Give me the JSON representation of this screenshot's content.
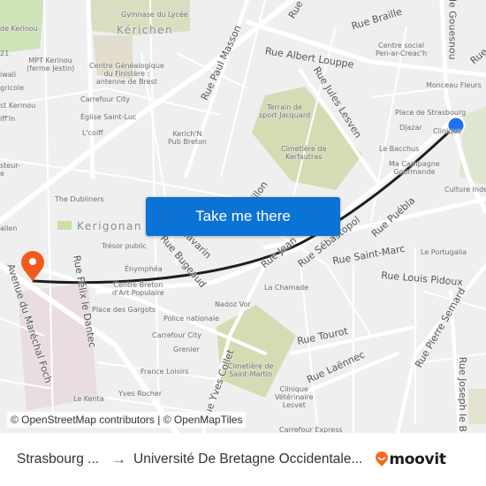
{
  "map": {
    "districts": [
      {
        "id": "kerichen",
        "label": "Kérichen"
      },
      {
        "id": "kerigonan",
        "label": "Kerigonan"
      }
    ],
    "streets": [
      {
        "id": "rue-albert-louppe",
        "label": "Rue Albert Louppe"
      },
      {
        "id": "rue-braille",
        "label": "Rue Braille"
      },
      {
        "id": "rue-jules-lesven",
        "label": "Rue Jules Lesven"
      },
      {
        "id": "rue-paul-masson",
        "label": "Rue Paul Masson"
      },
      {
        "id": "rue-de-gouesnou",
        "label": "de Gouesnou"
      },
      {
        "id": "rue-top-right",
        "label": "Rue"
      },
      {
        "id": "rue-top-center",
        "label": "Rue"
      },
      {
        "id": "rue-sebastopol",
        "label": "Rue Sébastopol"
      },
      {
        "id": "rue-puebla",
        "label": "Rue Puébla"
      },
      {
        "id": "rue-saint-marc",
        "label": "Rue Saint-Marc"
      },
      {
        "id": "rue-louis-pidoux",
        "label": "Rue Louis Pidoux"
      },
      {
        "id": "rue-pierre-semard",
        "label": "Rue Pierre Semard"
      },
      {
        "id": "rue-joseph-le-b",
        "label": "Rue Joseph le B"
      },
      {
        "id": "rue-tourot",
        "label": "Rue Tourot"
      },
      {
        "id": "rue-laennec",
        "label": "Rue Laënnec"
      },
      {
        "id": "rue-jean-jaures",
        "label": "Rue Jean"
      },
      {
        "id": "rue-yves-collet",
        "label": "Rue Yves Collet"
      },
      {
        "id": "rue-bugeaud",
        "label": "Rue Bugeaud"
      },
      {
        "id": "rue-navarin",
        "label": "Navarin"
      },
      {
        "id": "rue-vauban",
        "label": "illon"
      },
      {
        "id": "rue-felix-le-dantec",
        "label": "Rue Félix le Dantec"
      },
      {
        "id": "avenue-marechal-foch",
        "label": "Avenue du Maréchal Foch"
      }
    ],
    "pois": [
      {
        "id": "gymnase",
        "label": "Gymnase du Lycée"
      },
      {
        "id": "kerinou-1",
        "label": "de Kerinou"
      },
      {
        "id": "mpt-kerinou",
        "label": "MPT Kerinou\n(ferme Jestin)"
      },
      {
        "id": "diwali",
        "label": "iwali"
      },
      {
        "id": "agricole",
        "label": "gricole"
      },
      {
        "id": "kerinou-2",
        "label": "st Kerinou"
      },
      {
        "id": "iffin",
        "label": "iff'In"
      },
      {
        "id": "num21",
        "label": "21"
      },
      {
        "id": "centre-genealogique",
        "label": "Centre Généalogique\ndu Finistère :\nantenne de Brest"
      },
      {
        "id": "carrefour-city-1",
        "label": "Carrefour City"
      },
      {
        "id": "eglise-saint-luc",
        "label": "Église Saint-Luc"
      },
      {
        "id": "lcoiff",
        "label": "L'coiff"
      },
      {
        "id": "kerichn-pub",
        "label": "Kerich'N\nPub Breton"
      },
      {
        "id": "pasteur",
        "label": "steur-\ne"
      },
      {
        "id": "centre-social",
        "label": "Centre social\nPen-ar-Creac'h"
      },
      {
        "id": "monceau-fleurs",
        "label": "Monceau Fleurs"
      },
      {
        "id": "place-strasbourg",
        "label": "Place de Strasbourg"
      },
      {
        "id": "djazar",
        "label": "Djazar"
      },
      {
        "id": "clinique",
        "label": "Clinique"
      },
      {
        "id": "terrain-jacquard",
        "label": "Terrain de\nsport Jacquard"
      },
      {
        "id": "cimetiere-kerfautras",
        "label": "Cimetière de\nKerfautras"
      },
      {
        "id": "le-bacchus",
        "label": "Le Bacchus"
      },
      {
        "id": "ma-campagne",
        "label": "Ma Campagne\nGourmande"
      },
      {
        "id": "culture-inde",
        "label": "Culture Inde"
      },
      {
        "id": "the-dubliners",
        "label": "The Dubliners"
      },
      {
        "id": "allen",
        "label": "allen"
      },
      {
        "id": "tresor-public",
        "label": "Trésor public"
      },
      {
        "id": "enymphea",
        "label": "Énymphéa"
      },
      {
        "id": "centre-breton",
        "label": "Centre Breton\nd'Art Populaire"
      },
      {
        "id": "place-gargots",
        "label": "Place des Gargots"
      },
      {
        "id": "police",
        "label": "Police nationale"
      },
      {
        "id": "carrefour-city-2",
        "label": "Carrefour City"
      },
      {
        "id": "grenier",
        "label": "Grenier"
      },
      {
        "id": "france-loisirs",
        "label": "France Loisirs"
      },
      {
        "id": "yves-rocher",
        "label": "Yves Rocher"
      },
      {
        "id": "le-kenta",
        "label": "Le Kenta"
      },
      {
        "id": "nadoz-vor",
        "label": "Nadoz Vor"
      },
      {
        "id": "la-chamade",
        "label": "La Chamade"
      },
      {
        "id": "cimetiere-saint-martin",
        "label": "Cimetière de\nSaint-Martin"
      },
      {
        "id": "clinique-veterinaire",
        "label": "Clinique\nVétérinaire\nLesvet"
      },
      {
        "id": "carrefour-express",
        "label": "Carrefour Express"
      },
      {
        "id": "le-portugalia",
        "label": "Le Portugalia"
      }
    ],
    "origin_marker": {
      "label": "origin-stop",
      "color": "#1f6ff0"
    },
    "destination_marker": {
      "label": "destination",
      "color": "#f25a1d"
    },
    "route_color": "#1c1c1c",
    "attribution": "© OpenStreetMap contributors | © OpenMapTiles"
  },
  "cta": {
    "label": "Take me there",
    "color": "#0b72d6"
  },
  "footer": {
    "origin": "Strasbourg ...",
    "arrow": "→",
    "destination": "Université De Bretagne Occidentale...",
    "brand": "moovit",
    "brand_color": "#f26a21"
  }
}
